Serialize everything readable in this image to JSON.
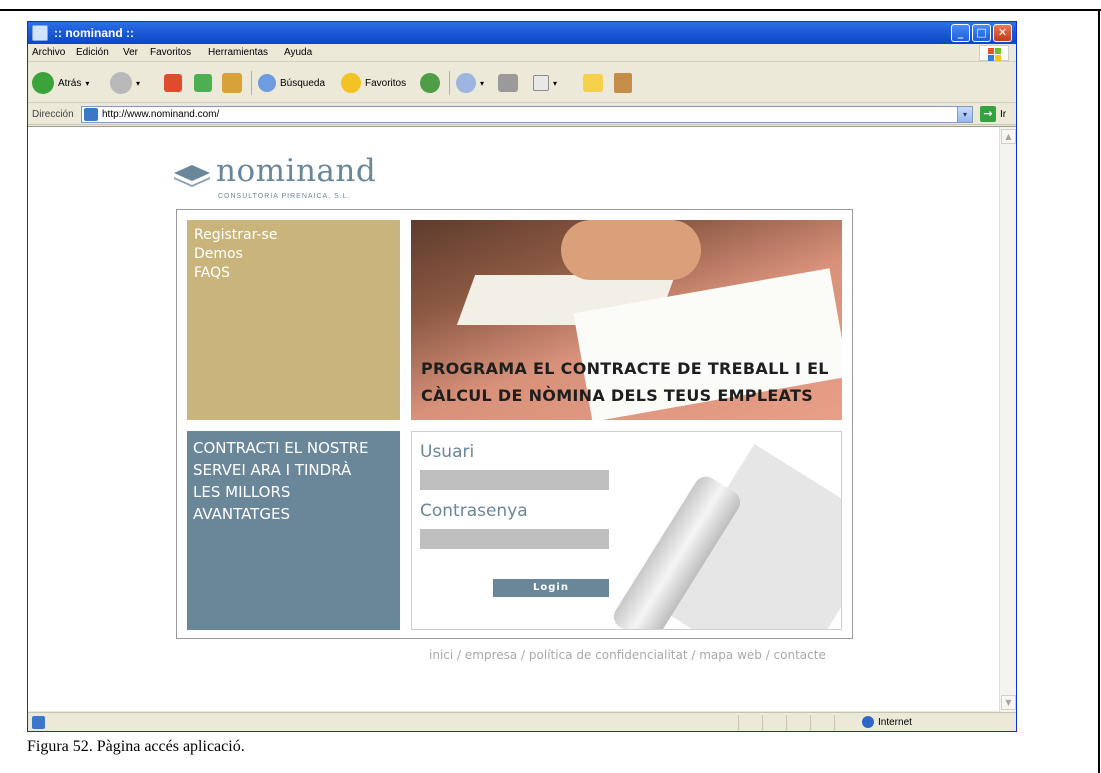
{
  "window": {
    "title": ":: nominand ::",
    "minimize_glyph": "_",
    "maximize_glyph": "□",
    "close_glyph": "✕"
  },
  "menubar": {
    "items": [
      "Archivo",
      "Edición",
      "Ver",
      "Favoritos",
      "Herramientas",
      "Ayuda"
    ]
  },
  "toolbar": {
    "back_label": "Atrás",
    "search_label": "Búsqueda",
    "favorites_label": "Favoritos",
    "dropdown_glyph": "▾"
  },
  "addressbar": {
    "label": "Dirección",
    "url": "http://www.nominand.com/",
    "go_label": "Ir",
    "go_glyph": "→",
    "dropdown_glyph": "▾"
  },
  "page": {
    "brand": {
      "name": "nominand",
      "tagline": "CONSULTORIA PIRENAICA, S.L."
    },
    "side_links": [
      "Registrar-se",
      "Demos",
      "FAQS"
    ],
    "hero_text_line1": "PROGRAMA EL CONTRACTE DE TREBALL I EL",
    "hero_text_line2": "CÀLCUL DE NÒMINA DELS TEUS EMPLEATS",
    "promo_lines": [
      "CONTRACTI EL NOSTRE",
      "SERVEI ARA I TINDRÀ",
      "LES MILLORS",
      "AVANTATGES"
    ],
    "login": {
      "user_label": "Usuari",
      "user_value": "",
      "password_label": "Contrasenya",
      "password_value": "",
      "button_label": "Login"
    },
    "footer_links": "inici / empresa / política de confidencialitat / mapa web / contacte"
  },
  "scrollbar": {
    "up_glyph": "▲",
    "down_glyph": "▼"
  },
  "statusbar": {
    "zone": "Internet"
  },
  "caption": "Figura 52. Pàgina accés aplicació.",
  "colors": {
    "brand_blue_gray": "#6a8699",
    "gold": "#c9b57c",
    "input_gray": "#bfbfbf",
    "footer_gray": "#a9a9a9",
    "xp_title_blue": "#1d5ad8"
  }
}
